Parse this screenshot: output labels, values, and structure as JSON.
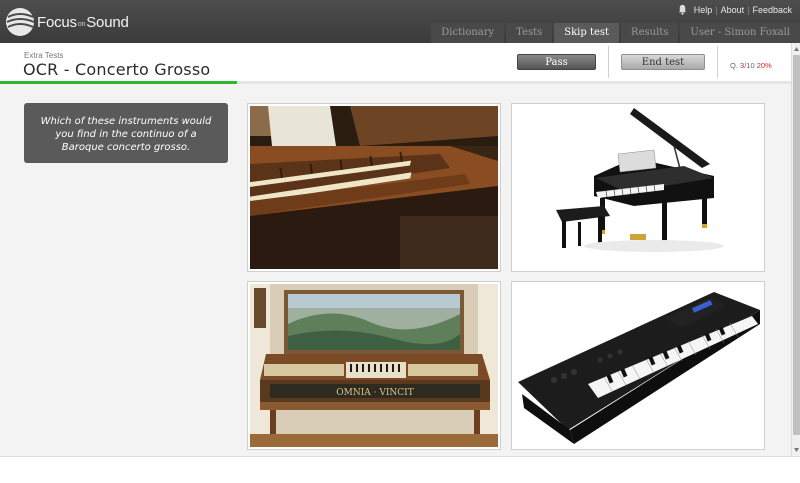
{
  "app": {
    "brand": "Focus",
    "brand_on": "on",
    "brand_end": "Sound"
  },
  "toplinks": {
    "help": "Help",
    "about": "About",
    "feedback": "Feedback"
  },
  "tabs": [
    {
      "label": "Dictionary",
      "active": false
    },
    {
      "label": "Tests",
      "active": false
    },
    {
      "label": "Skip test",
      "active": true
    },
    {
      "label": "Results",
      "active": false
    },
    {
      "label": "User - Simon Foxall",
      "active": false
    }
  ],
  "header": {
    "subtitle": "Extra Tests",
    "title": "OCR - Concerto Grosso",
    "pass_label": "Pass",
    "end_label": "End test",
    "counter_prefix": "Q. ",
    "counter_current": "3",
    "counter_total": "/10 ",
    "counter_percent": "20%"
  },
  "progress": {
    "fraction": 0.3
  },
  "question": {
    "text": "Which of these instruments would you find in the continuo of a Baroque concerto grosso."
  },
  "options": [
    {
      "image": "harpsichord-keyboard"
    },
    {
      "image": "grand-piano"
    },
    {
      "image": "virginal"
    },
    {
      "image": "digital-synthesizer-keyboard"
    }
  ],
  "colors": {
    "header_bg": "#3b3b3b",
    "progress": "#2eb82e",
    "question_bg": "#5a5a5a",
    "accent_red": "#d22222"
  }
}
